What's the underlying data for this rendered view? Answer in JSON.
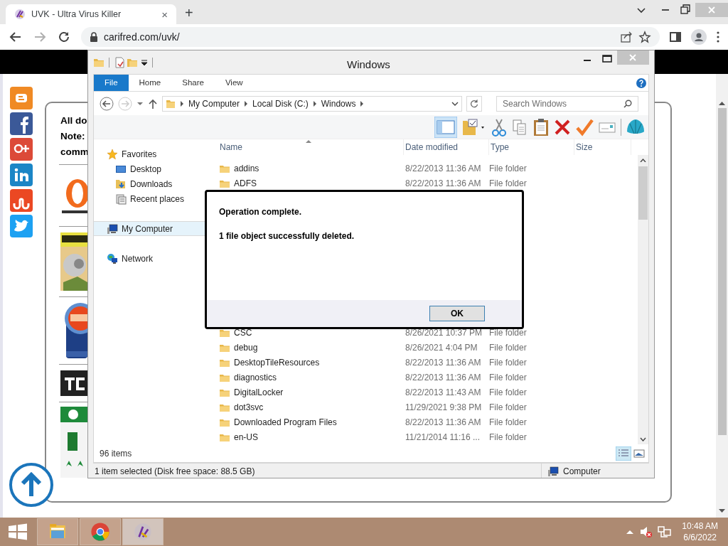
{
  "browser": {
    "tab": {
      "title": "UVK - Ultra Virus Killer",
      "close": "×"
    },
    "new_tab": "+",
    "url": "carifred.com/uvk/"
  },
  "web_page": {
    "text_lines": [
      "All do",
      "Note:",
      "comm"
    ]
  },
  "explorer": {
    "title": "Windows",
    "ribbon_tabs": [
      {
        "label": "File",
        "selected": true
      },
      {
        "label": "Home",
        "selected": false
      },
      {
        "label": "Share",
        "selected": false
      },
      {
        "label": "View",
        "selected": false
      }
    ],
    "path": [
      "My Computer",
      "Local Disk (C:)",
      "Windows"
    ],
    "search": {
      "placeholder": "Search Windows"
    },
    "nav": [
      {
        "label": "Favorites",
        "kind": "star",
        "selected": false,
        "children": [
          {
            "label": "Desktop",
            "kind": "desktop",
            "selected": false
          },
          {
            "label": "Downloads",
            "kind": "downloads",
            "selected": false
          },
          {
            "label": "Recent places",
            "kind": "recent",
            "selected": false
          }
        ]
      },
      {
        "label": "My Computer",
        "kind": "computer",
        "selected": true
      },
      {
        "label": "Network",
        "kind": "network",
        "selected": false
      }
    ],
    "columns": [
      "Name",
      "Date modified",
      "Type",
      "Size"
    ],
    "rows_above": [
      {
        "name": "addins",
        "date": "8/22/2013 11:36 AM",
        "type": "File folder"
      },
      {
        "name": "ADFS",
        "date": "8/22/2013 11:36 AM",
        "type": "File folder"
      }
    ],
    "rows_below": [
      {
        "name": "CSC",
        "date": "8/26/2021 10:37 PM",
        "type": "File folder"
      },
      {
        "name": "debug",
        "date": "8/26/2021 4:04 PM",
        "type": "File folder"
      },
      {
        "name": "DesktopTileResources",
        "date": "8/22/2013 11:36 AM",
        "type": "File folder"
      },
      {
        "name": "diagnostics",
        "date": "8/22/2013 11:36 AM",
        "type": "File folder"
      },
      {
        "name": "DigitalLocker",
        "date": "8/22/2013 11:43 AM",
        "type": "File folder"
      },
      {
        "name": "dot3svc",
        "date": "11/29/2021 9:38 PM",
        "type": "File folder"
      },
      {
        "name": "Downloaded Program Files",
        "date": "8/22/2013 11:36 AM",
        "type": "File folder"
      },
      {
        "name": "en-US",
        "date": "11/21/2014 11:16 ...",
        "type": "File folder"
      }
    ],
    "item_count": "96 items",
    "status": "1 item selected (Disk free space: 88.5 GB)",
    "location": "Computer"
  },
  "dialog": {
    "lines": [
      "Operation complete.",
      "1 file object successfully deleted."
    ],
    "button": "OK"
  },
  "taskbar": {
    "apps": [
      {
        "kind": "explorer",
        "selected": false
      },
      {
        "kind": "chrome",
        "selected": false
      },
      {
        "kind": "uvk",
        "selected": true
      }
    ],
    "time": "10:48 AM",
    "date": "6/6/2022"
  }
}
